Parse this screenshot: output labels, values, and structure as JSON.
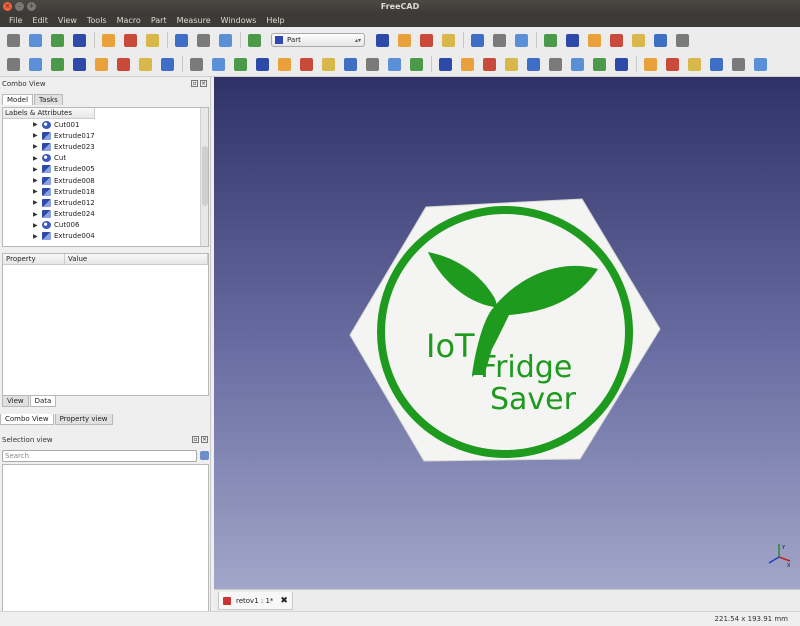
{
  "window": {
    "title": "FreeCAD"
  },
  "menu": [
    "File",
    "Edit",
    "View",
    "Tools",
    "Macro",
    "Part",
    "Measure",
    "Windows",
    "Help"
  ],
  "toolbar": {
    "workbench": "Part",
    "row1_icons": [
      "new-file",
      "open-file",
      "save-file",
      "print",
      "cut",
      "copy",
      "paste",
      "undo",
      "redo",
      "refresh",
      "whats-this",
      "record-macro",
      "stop-macro",
      "edit-macro",
      "run-macro",
      "fit-all",
      "fit-selection",
      "draw-style",
      "view-isometric",
      "view-front",
      "view-top",
      "view-right",
      "view-rear",
      "view-bottom",
      "view-left"
    ],
    "row2_icons": [
      "box",
      "cylinder",
      "sphere",
      "cone",
      "torus",
      "tube",
      "primitives",
      "shape-builder",
      "extrude",
      "revolve",
      "mirror",
      "fillet",
      "chamfer",
      "make-face",
      "ruled-surface",
      "loft",
      "sweep",
      "section",
      "cross-sections",
      "boolean",
      "cut",
      "fuse",
      "common",
      "join",
      "split",
      "compound",
      "check-geometry",
      "defeaturing",
      "measure-linear",
      "measure-angular",
      "measure-refresh",
      "measure-clear",
      "toggle-3d",
      "toggle-delta"
    ]
  },
  "combo": {
    "title": "Combo View",
    "tabs": [
      "Model",
      "Tasks"
    ],
    "tree_header": "Labels & Attributes",
    "tree_items": [
      {
        "label": "Cut001",
        "kind": "cut"
      },
      {
        "label": "Extrude017",
        "kind": "extrude"
      },
      {
        "label": "Extrude023",
        "kind": "extrude"
      },
      {
        "label": "Cut",
        "kind": "cut"
      },
      {
        "label": "Extrude005",
        "kind": "extrude"
      },
      {
        "label": "Extrude008",
        "kind": "extrude"
      },
      {
        "label": "Extrude018",
        "kind": "extrude"
      },
      {
        "label": "Extrude012",
        "kind": "extrude"
      },
      {
        "label": "Extrude024",
        "kind": "extrude"
      },
      {
        "label": "Cut006",
        "kind": "cut"
      },
      {
        "label": "Extrude004",
        "kind": "extrude"
      }
    ],
    "prop_columns": [
      "Property",
      "Value"
    ],
    "prop_tabs": [
      "View",
      "Data"
    ],
    "bottom_tabs": [
      "Combo View",
      "Property view"
    ]
  },
  "selection": {
    "title": "Selection view",
    "search_placeholder": "Search"
  },
  "viewer": {
    "logo_line1": "IoT",
    "logo_line2": "Fridge",
    "logo_line3": "Saver",
    "logo_green": "#1e9a1e"
  },
  "document": {
    "tab_label": "retov1 : 1*"
  },
  "status": {
    "dimensions": "221.54 x 193.91 mm"
  }
}
